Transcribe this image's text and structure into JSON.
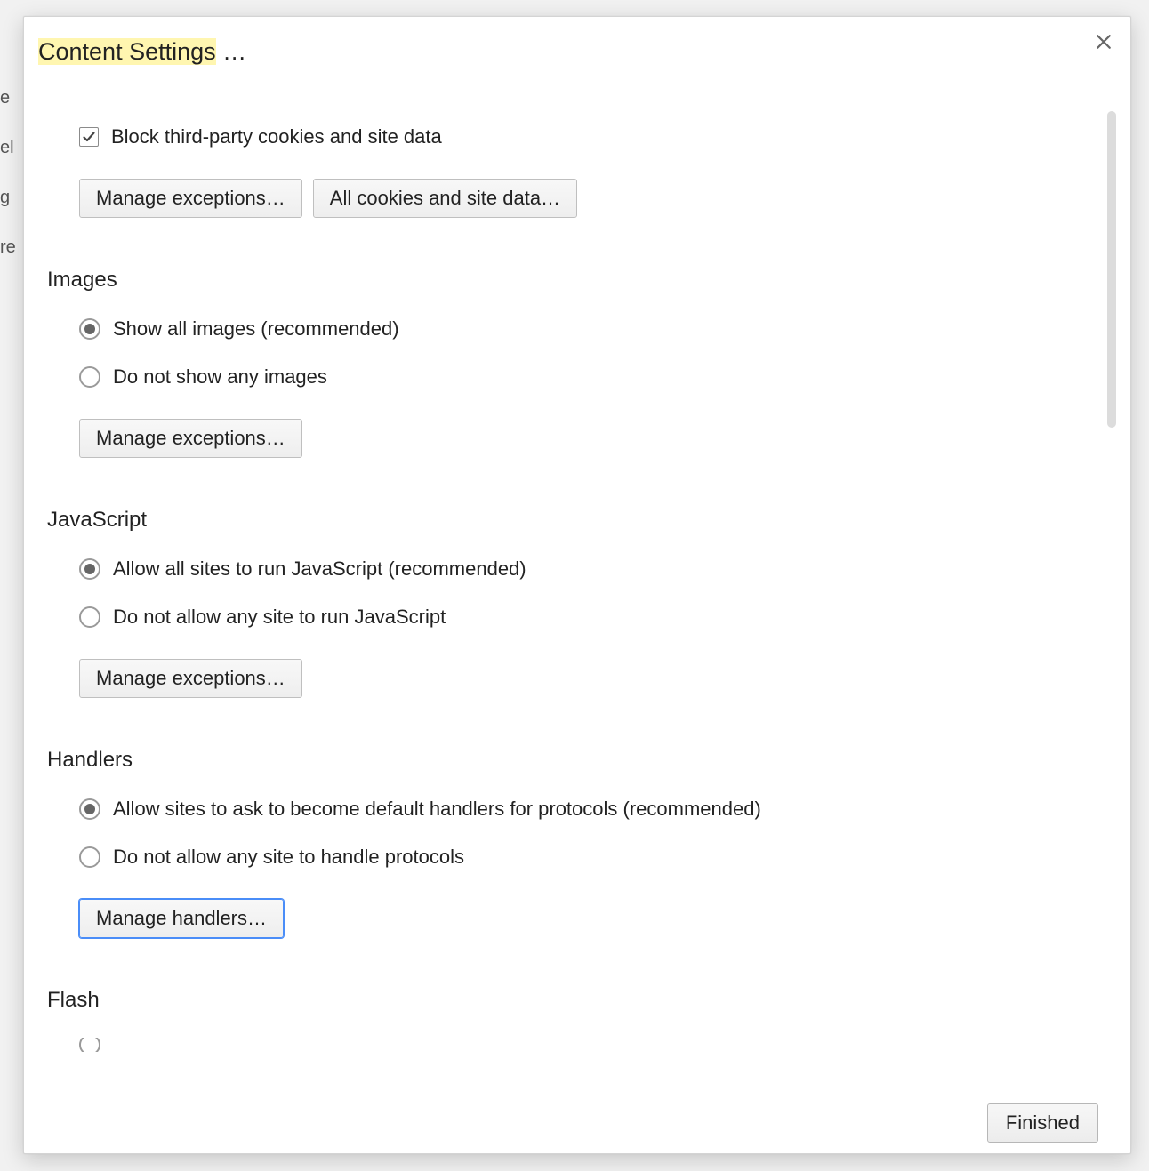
{
  "background_fragments": [
    "e",
    "el",
    "g",
    "re"
  ],
  "modal": {
    "title_highlight": "Content Settings",
    "title_suffix": " …",
    "close_label": "Close",
    "finished_label": "Finished"
  },
  "cookies": {
    "block_third_party_label": "Block third-party cookies and site data",
    "block_third_party_checked": true,
    "manage_exceptions_label": "Manage exceptions…",
    "all_cookies_label": "All cookies and site data…"
  },
  "images": {
    "heading": "Images",
    "options": [
      {
        "label": "Show all images (recommended)",
        "selected": true
      },
      {
        "label": "Do not show any images",
        "selected": false
      }
    ],
    "manage_exceptions_label": "Manage exceptions…"
  },
  "javascript": {
    "heading": "JavaScript",
    "options": [
      {
        "label": "Allow all sites to run JavaScript (recommended)",
        "selected": true
      },
      {
        "label": "Do not allow any site to run JavaScript",
        "selected": false
      }
    ],
    "manage_exceptions_label": "Manage exceptions…"
  },
  "handlers": {
    "heading": "Handlers",
    "options": [
      {
        "label": "Allow sites to ask to become default handlers for protocols (recommended)",
        "selected": true
      },
      {
        "label": "Do not allow any site to handle protocols",
        "selected": false
      }
    ],
    "manage_handlers_label": "Manage handlers…"
  },
  "flash": {
    "heading": "Flash"
  }
}
